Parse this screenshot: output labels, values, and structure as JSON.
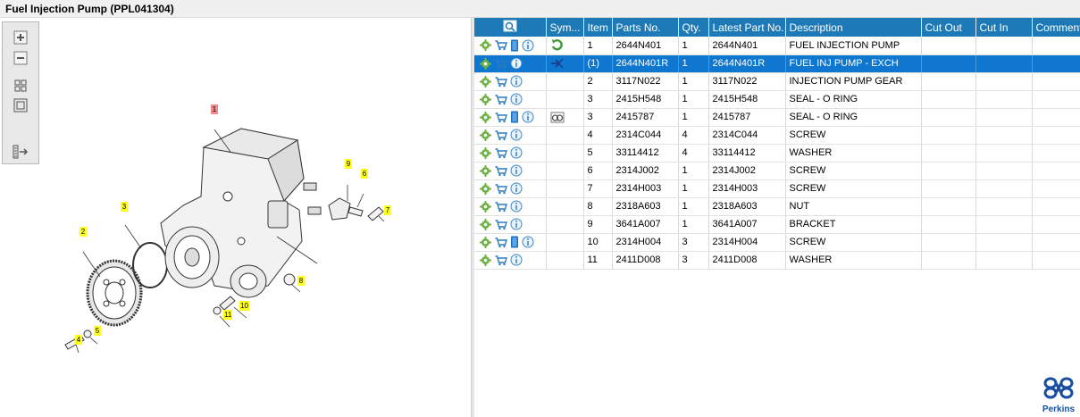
{
  "window": {
    "title": "Fuel Injection Pump (PPL041304)"
  },
  "toolbar": [
    {
      "icon": "zoom-in-icon"
    },
    {
      "icon": "zoom-out-icon"
    },
    {
      "icon": "fit-all-icon"
    },
    {
      "icon": "fit-window-icon"
    },
    {
      "icon": "export-icon"
    }
  ],
  "diagram": {
    "callouts": [
      "1",
      "2",
      "3",
      "4",
      "5",
      "6",
      "7",
      "8",
      "9",
      "10",
      "11"
    ]
  },
  "grid": {
    "columns": [
      "",
      "Sym...",
      "Item",
      "Parts No.",
      "Qty.",
      "Latest Part No.",
      "Description",
      "Cut Out",
      "Cut In",
      "Comment"
    ],
    "rows": [
      {
        "icons": [
          "gear",
          "cart",
          "book",
          "info"
        ],
        "symbol": "rotate",
        "item": "1",
        "part": "2644N401",
        "qty": "1",
        "latest": "2644N401",
        "desc": "FUEL INJECTION PUMP",
        "selected": false
      },
      {
        "icons": [
          "gear",
          "cart",
          "info"
        ],
        "symbol": "exchange",
        "item": "(1)",
        "part": "2644N401R",
        "qty": "1",
        "latest": "2644N401R",
        "desc": "FUEL INJ PUMP - EXCH",
        "selected": true
      },
      {
        "icons": [
          "gear",
          "cart",
          "info"
        ],
        "symbol": "",
        "item": "2",
        "part": "3117N022",
        "qty": "1",
        "latest": "3117N022",
        "desc": "INJECTION PUMP GEAR",
        "selected": false
      },
      {
        "icons": [
          "gear",
          "cart",
          "info"
        ],
        "symbol": "",
        "item": "3",
        "part": "2415H548",
        "qty": "1",
        "latest": "2415H548",
        "desc": "SEAL - O RING",
        "selected": false
      },
      {
        "icons": [
          "gear",
          "cart",
          "book",
          "info"
        ],
        "symbol": "binoculars",
        "item": "3",
        "part": "2415787",
        "qty": "1",
        "latest": "2415787",
        "desc": "SEAL - O RING",
        "selected": false
      },
      {
        "icons": [
          "gear",
          "cart",
          "info"
        ],
        "symbol": "",
        "item": "4",
        "part": "2314C044",
        "qty": "4",
        "latest": "2314C044",
        "desc": "SCREW",
        "selected": false
      },
      {
        "icons": [
          "gear",
          "cart",
          "info"
        ],
        "symbol": "",
        "item": "5",
        "part": "33114412",
        "qty": "4",
        "latest": "33114412",
        "desc": "WASHER",
        "selected": false
      },
      {
        "icons": [
          "gear",
          "cart",
          "info"
        ],
        "symbol": "",
        "item": "6",
        "part": "2314J002",
        "qty": "1",
        "latest": "2314J002",
        "desc": "SCREW",
        "selected": false
      },
      {
        "icons": [
          "gear",
          "cart",
          "info"
        ],
        "symbol": "",
        "item": "7",
        "part": "2314H003",
        "qty": "1",
        "latest": "2314H003",
        "desc": "SCREW",
        "selected": false
      },
      {
        "icons": [
          "gear",
          "cart",
          "info"
        ],
        "symbol": "",
        "item": "8",
        "part": "2318A603",
        "qty": "1",
        "latest": "2318A603",
        "desc": "NUT",
        "selected": false
      },
      {
        "icons": [
          "gear",
          "cart",
          "info"
        ],
        "symbol": "",
        "item": "9",
        "part": "3641A007",
        "qty": "1",
        "latest": "3641A007",
        "desc": "BRACKET",
        "selected": false
      },
      {
        "icons": [
          "gear",
          "cart",
          "book",
          "info"
        ],
        "symbol": "",
        "item": "10",
        "part": "2314H004",
        "qty": "3",
        "latest": "2314H004",
        "desc": "SCREW",
        "selected": false
      },
      {
        "icons": [
          "gear",
          "cart",
          "info"
        ],
        "symbol": "",
        "item": "11",
        "part": "2411D008",
        "qty": "3",
        "latest": "2411D008",
        "desc": "WASHER",
        "selected": false
      }
    ]
  },
  "brand": {
    "name": "Perkins",
    "color": "#1a4fa0"
  },
  "colors": {
    "header": "#1e7ab7",
    "selected": "#0f77cf",
    "callout": "#ffff1e",
    "callout_main": "#f08a8a"
  }
}
